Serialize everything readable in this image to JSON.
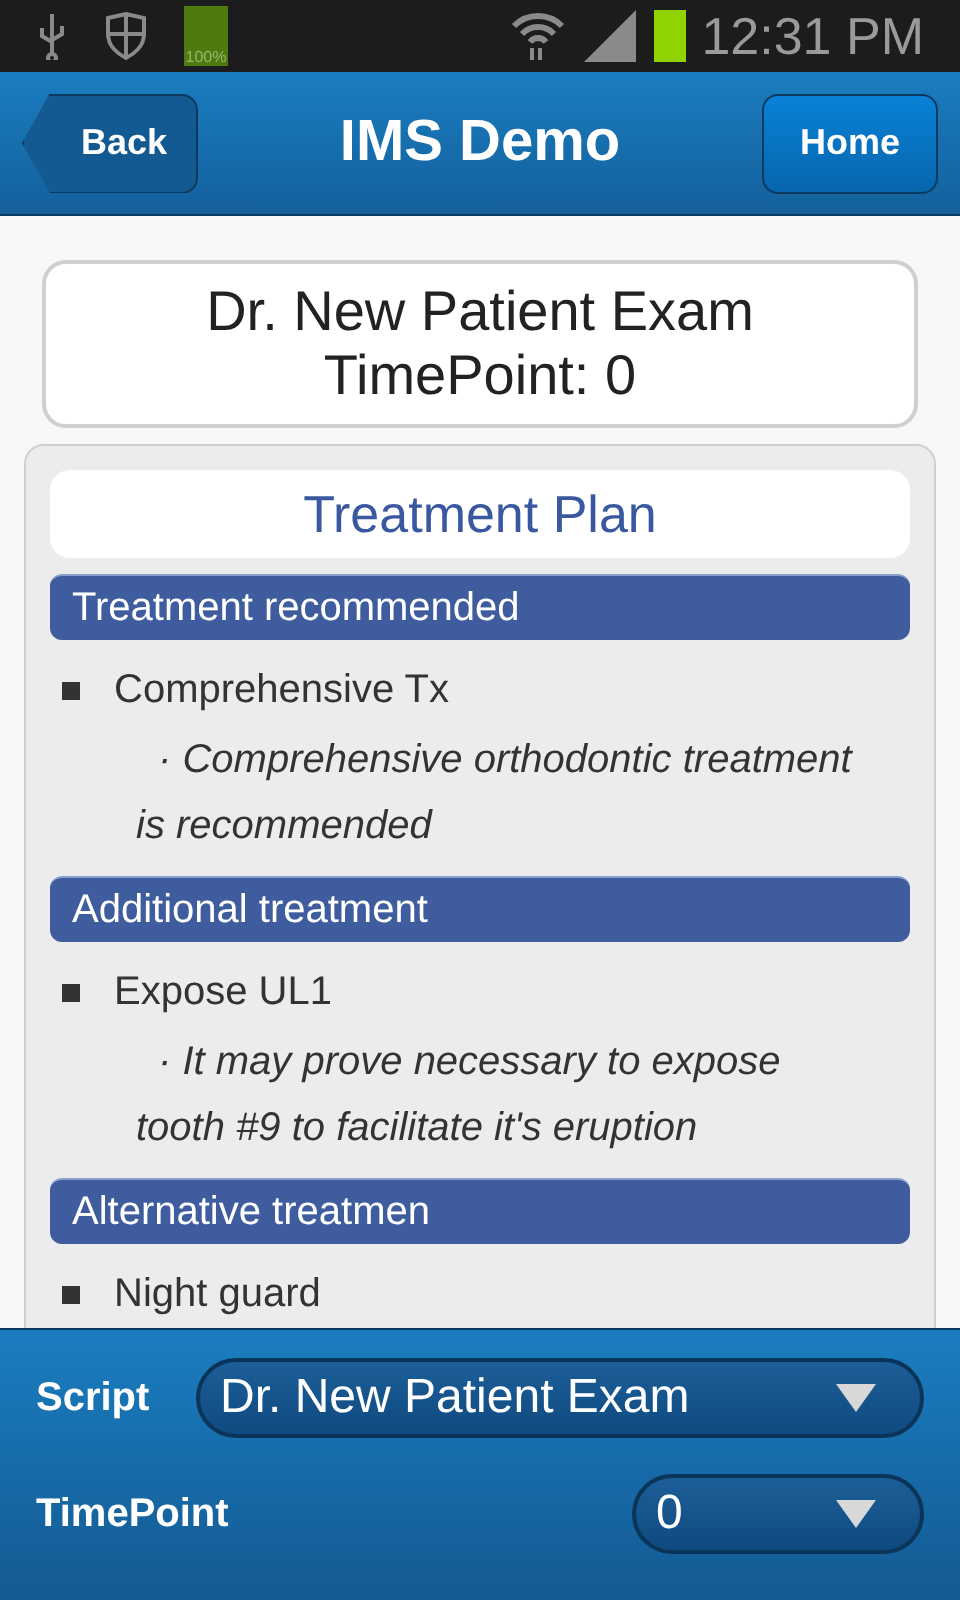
{
  "status_bar": {
    "battery_label": "100%",
    "time": "12:31 PM"
  },
  "header": {
    "back": "Back",
    "title": "IMS Demo",
    "home": "Home"
  },
  "exam_card": {
    "lines": [
      "Dr. New Patient Exam",
      "TimePoint: 0"
    ]
  },
  "panel": {
    "title": "Treatment Plan",
    "sections": [
      {
        "heading": "Treatment recommended",
        "items": [
          {
            "label": "Comprehensive Tx",
            "note": "· Comprehensive orthodontic treatment is recommended"
          }
        ]
      },
      {
        "heading": "Additional treatment",
        "items": [
          {
            "label": "Expose UL1",
            "note": "· It may prove necessary to expose tooth #9 to facilitate it's eruption"
          }
        ]
      },
      {
        "heading": "Alternative treatmen",
        "items": [
          {
            "label": "Night guard"
          }
        ]
      }
    ]
  },
  "footer": {
    "fields": [
      {
        "label": "Script",
        "value": "Dr. New Patient Exam"
      },
      {
        "label": "TimePoint",
        "value": "0"
      }
    ]
  }
}
